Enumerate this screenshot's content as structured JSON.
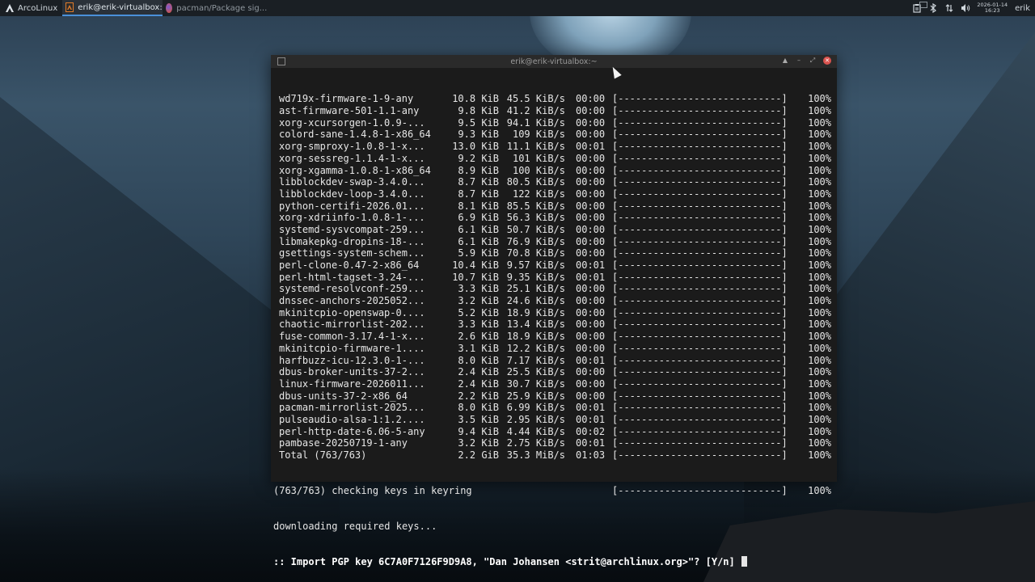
{
  "panel": {
    "menu_label": "ArcoLinux",
    "tasks": [
      {
        "label": "erik@erik-virtualbox:~",
        "active": true
      },
      {
        "label": "pacman/Package sig...",
        "active": false
      }
    ],
    "clock_date": "2026-01-14",
    "clock_time": "16:23",
    "user": "erik",
    "tray_icons": [
      "clipboard-icon",
      "bluetooth-icon",
      "network-icon",
      "volume-icon"
    ]
  },
  "window": {
    "title": "erik@erik-virtualbox:~"
  },
  "terminal": {
    "downloads": [
      {
        "name": "wd719x-firmware-1-9-any",
        "size": "10.8 KiB",
        "rate": "45.5 KiB/s",
        "time": "00:00",
        "bar": "[----------------------------]",
        "pct": "100%"
      },
      {
        "name": "ast-firmware-501-1.1-any",
        "size": "9.8 KiB",
        "rate": "41.2 KiB/s",
        "time": "00:00",
        "bar": "[----------------------------]",
        "pct": "100%"
      },
      {
        "name": "xorg-xcursorgen-1.0.9-...",
        "size": "9.5 KiB",
        "rate": "94.1 KiB/s",
        "time": "00:00",
        "bar": "[----------------------------]",
        "pct": "100%"
      },
      {
        "name": "colord-sane-1.4.8-1-x86_64",
        "size": "9.3 KiB",
        "rate": "109 KiB/s",
        "time": "00:00",
        "bar": "[----------------------------]",
        "pct": "100%"
      },
      {
        "name": "xorg-smproxy-1.0.8-1-x...",
        "size": "13.0 KiB",
        "rate": "11.1 KiB/s",
        "time": "00:01",
        "bar": "[----------------------------]",
        "pct": "100%"
      },
      {
        "name": "xorg-sessreg-1.1.4-1-x...",
        "size": "9.2 KiB",
        "rate": "101 KiB/s",
        "time": "00:00",
        "bar": "[----------------------------]",
        "pct": "100%"
      },
      {
        "name": "xorg-xgamma-1.0.8-1-x86_64",
        "size": "8.9 KiB",
        "rate": "100 KiB/s",
        "time": "00:00",
        "bar": "[----------------------------]",
        "pct": "100%"
      },
      {
        "name": "libblockdev-swap-3.4.0...",
        "size": "8.7 KiB",
        "rate": "80.5 KiB/s",
        "time": "00:00",
        "bar": "[----------------------------]",
        "pct": "100%"
      },
      {
        "name": "libblockdev-loop-3.4.0...",
        "size": "8.7 KiB",
        "rate": "122 KiB/s",
        "time": "00:00",
        "bar": "[----------------------------]",
        "pct": "100%"
      },
      {
        "name": "python-certifi-2026.01...",
        "size": "8.1 KiB",
        "rate": "85.5 KiB/s",
        "time": "00:00",
        "bar": "[----------------------------]",
        "pct": "100%"
      },
      {
        "name": "xorg-xdriinfo-1.0.8-1-...",
        "size": "6.9 KiB",
        "rate": "56.3 KiB/s",
        "time": "00:00",
        "bar": "[----------------------------]",
        "pct": "100%"
      },
      {
        "name": "systemd-sysvcompat-259...",
        "size": "6.1 KiB",
        "rate": "50.7 KiB/s",
        "time": "00:00",
        "bar": "[----------------------------]",
        "pct": "100%"
      },
      {
        "name": "libmakepkg-dropins-18-...",
        "size": "6.1 KiB",
        "rate": "76.9 KiB/s",
        "time": "00:00",
        "bar": "[----------------------------]",
        "pct": "100%"
      },
      {
        "name": "gsettings-system-schem...",
        "size": "5.9 KiB",
        "rate": "70.8 KiB/s",
        "time": "00:00",
        "bar": "[----------------------------]",
        "pct": "100%"
      },
      {
        "name": "perl-clone-0.47-2-x86_64",
        "size": "10.4 KiB",
        "rate": "9.57 KiB/s",
        "time": "00:01",
        "bar": "[----------------------------]",
        "pct": "100%"
      },
      {
        "name": "perl-html-tagset-3.24-...",
        "size": "10.7 KiB",
        "rate": "9.35 KiB/s",
        "time": "00:01",
        "bar": "[----------------------------]",
        "pct": "100%"
      },
      {
        "name": "systemd-resolvconf-259...",
        "size": "3.3 KiB",
        "rate": "25.1 KiB/s",
        "time": "00:00",
        "bar": "[----------------------------]",
        "pct": "100%"
      },
      {
        "name": "dnssec-anchors-2025052...",
        "size": "3.2 KiB",
        "rate": "24.6 KiB/s",
        "time": "00:00",
        "bar": "[----------------------------]",
        "pct": "100%"
      },
      {
        "name": "mkinitcpio-openswap-0....",
        "size": "5.2 KiB",
        "rate": "18.9 KiB/s",
        "time": "00:00",
        "bar": "[----------------------------]",
        "pct": "100%"
      },
      {
        "name": "chaotic-mirrorlist-202...",
        "size": "3.3 KiB",
        "rate": "13.4 KiB/s",
        "time": "00:00",
        "bar": "[----------------------------]",
        "pct": "100%"
      },
      {
        "name": "fuse-common-3.17.4-1-x...",
        "size": "2.6 KiB",
        "rate": "18.9 KiB/s",
        "time": "00:00",
        "bar": "[----------------------------]",
        "pct": "100%"
      },
      {
        "name": "mkinitcpio-firmware-1....",
        "size": "3.1 KiB",
        "rate": "12.2 KiB/s",
        "time": "00:00",
        "bar": "[----------------------------]",
        "pct": "100%"
      },
      {
        "name": "harfbuzz-icu-12.3.0-1-...",
        "size": "8.0 KiB",
        "rate": "7.17 KiB/s",
        "time": "00:01",
        "bar": "[----------------------------]",
        "pct": "100%"
      },
      {
        "name": "dbus-broker-units-37-2...",
        "size": "2.4 KiB",
        "rate": "25.5 KiB/s",
        "time": "00:00",
        "bar": "[----------------------------]",
        "pct": "100%"
      },
      {
        "name": "linux-firmware-2026011...",
        "size": "2.4 KiB",
        "rate": "30.7 KiB/s",
        "time": "00:00",
        "bar": "[----------------------------]",
        "pct": "100%"
      },
      {
        "name": "dbus-units-37-2-x86_64",
        "size": "2.2 KiB",
        "rate": "25.9 KiB/s",
        "time": "00:00",
        "bar": "[----------------------------]",
        "pct": "100%"
      },
      {
        "name": "pacman-mirrorlist-2025...",
        "size": "8.0 KiB",
        "rate": "6.99 KiB/s",
        "time": "00:01",
        "bar": "[----------------------------]",
        "pct": "100%"
      },
      {
        "name": "pulseaudio-alsa-1:1.2....",
        "size": "3.5 KiB",
        "rate": "2.95 KiB/s",
        "time": "00:01",
        "bar": "[----------------------------]",
        "pct": "100%"
      },
      {
        "name": "perl-http-date-6.06-5-any",
        "size": "9.4 KiB",
        "rate": "4.44 KiB/s",
        "time": "00:02",
        "bar": "[----------------------------]",
        "pct": "100%"
      },
      {
        "name": "pambase-20250719-1-any",
        "size": "3.2 KiB",
        "rate": "2.75 KiB/s",
        "time": "00:01",
        "bar": "[----------------------------]",
        "pct": "100%"
      },
      {
        "name": "Total (763/763)",
        "size": "2.2 GiB",
        "rate": "35.3 MiB/s",
        "time": "01:03",
        "bar": "[----------------------------]",
        "pct": "100%"
      }
    ],
    "keys_line": "(763/763) checking keys in keyring",
    "keys_bar": "[----------------------------]",
    "keys_pct": "100%",
    "downloading_line": "downloading required keys...",
    "prompt_line": ":: Import PGP key 6C7A0F7126F9D9A8, \"Dan Johansen <strit@archlinux.org>\"? [Y/n] "
  }
}
